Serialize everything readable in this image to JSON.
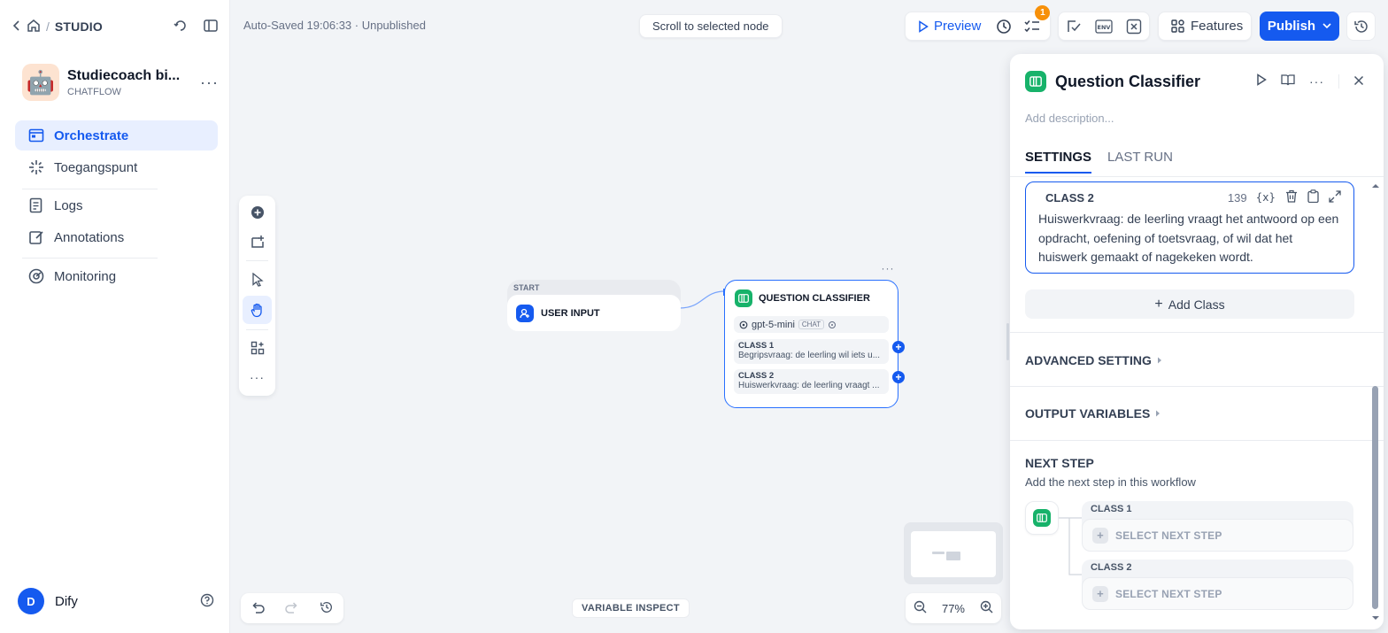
{
  "topbar": {
    "breadcrumb": "STUDIO",
    "autosave": "Auto-Saved 19:06:33 · Unpublished",
    "scroll_to_node": "Scroll to selected node",
    "preview": "Preview",
    "badge_count": "1",
    "features": "Features",
    "publish": "Publish"
  },
  "app": {
    "name": "Studiecoach bi...",
    "type": "CHATFLOW"
  },
  "sidebar": {
    "items": [
      {
        "label": "Orchestrate"
      },
      {
        "label": "Toegangspunt"
      },
      {
        "label": "Logs"
      },
      {
        "label": "Annotations"
      },
      {
        "label": "Monitoring"
      }
    ],
    "user": {
      "initial": "D",
      "name": "Dify"
    }
  },
  "canvas": {
    "start_node": {
      "label": "START",
      "title": "USER INPUT"
    },
    "qc_node": {
      "title": "QUESTION CLASSIFIER",
      "model": "gpt-5-mini",
      "model_tag": "CHAT",
      "classes": [
        {
          "title": "CLASS 1",
          "text": "Begripsvraag: de leerling wil iets u..."
        },
        {
          "title": "CLASS 2",
          "text": "Huiswerkvraag: de leerling vraagt ..."
        }
      ]
    },
    "variable_inspect": "VARIABLE INSPECT",
    "zoom": "77%"
  },
  "panel": {
    "title": "Question Classifier",
    "description_placeholder": "Add description...",
    "tabs": [
      {
        "label": "SETTINGS"
      },
      {
        "label": "LAST RUN"
      }
    ],
    "class2": {
      "title": "CLASS 2",
      "count": "139",
      "var_icon": "{x}",
      "text": "Huiswerkvraag: de leerling vraagt het antwoord op een opdracht, oefening of toetsvraag, of wil dat het huiswerk gemaakt of nagekeken wordt."
    },
    "add_class": "Add Class",
    "advanced_setting": "ADVANCED SETTING",
    "output_variables": "OUTPUT VARIABLES",
    "next_step": {
      "title": "NEXT STEP",
      "description": "Add the next step in this workflow",
      "branches": [
        {
          "label": "CLASS 1",
          "select": "SELECT NEXT STEP"
        },
        {
          "label": "CLASS 2",
          "select": "SELECT NEXT STEP"
        }
      ]
    }
  },
  "colors": {
    "accent": "#155aef",
    "classifier": "#17b26a",
    "badge": "#f79009"
  }
}
